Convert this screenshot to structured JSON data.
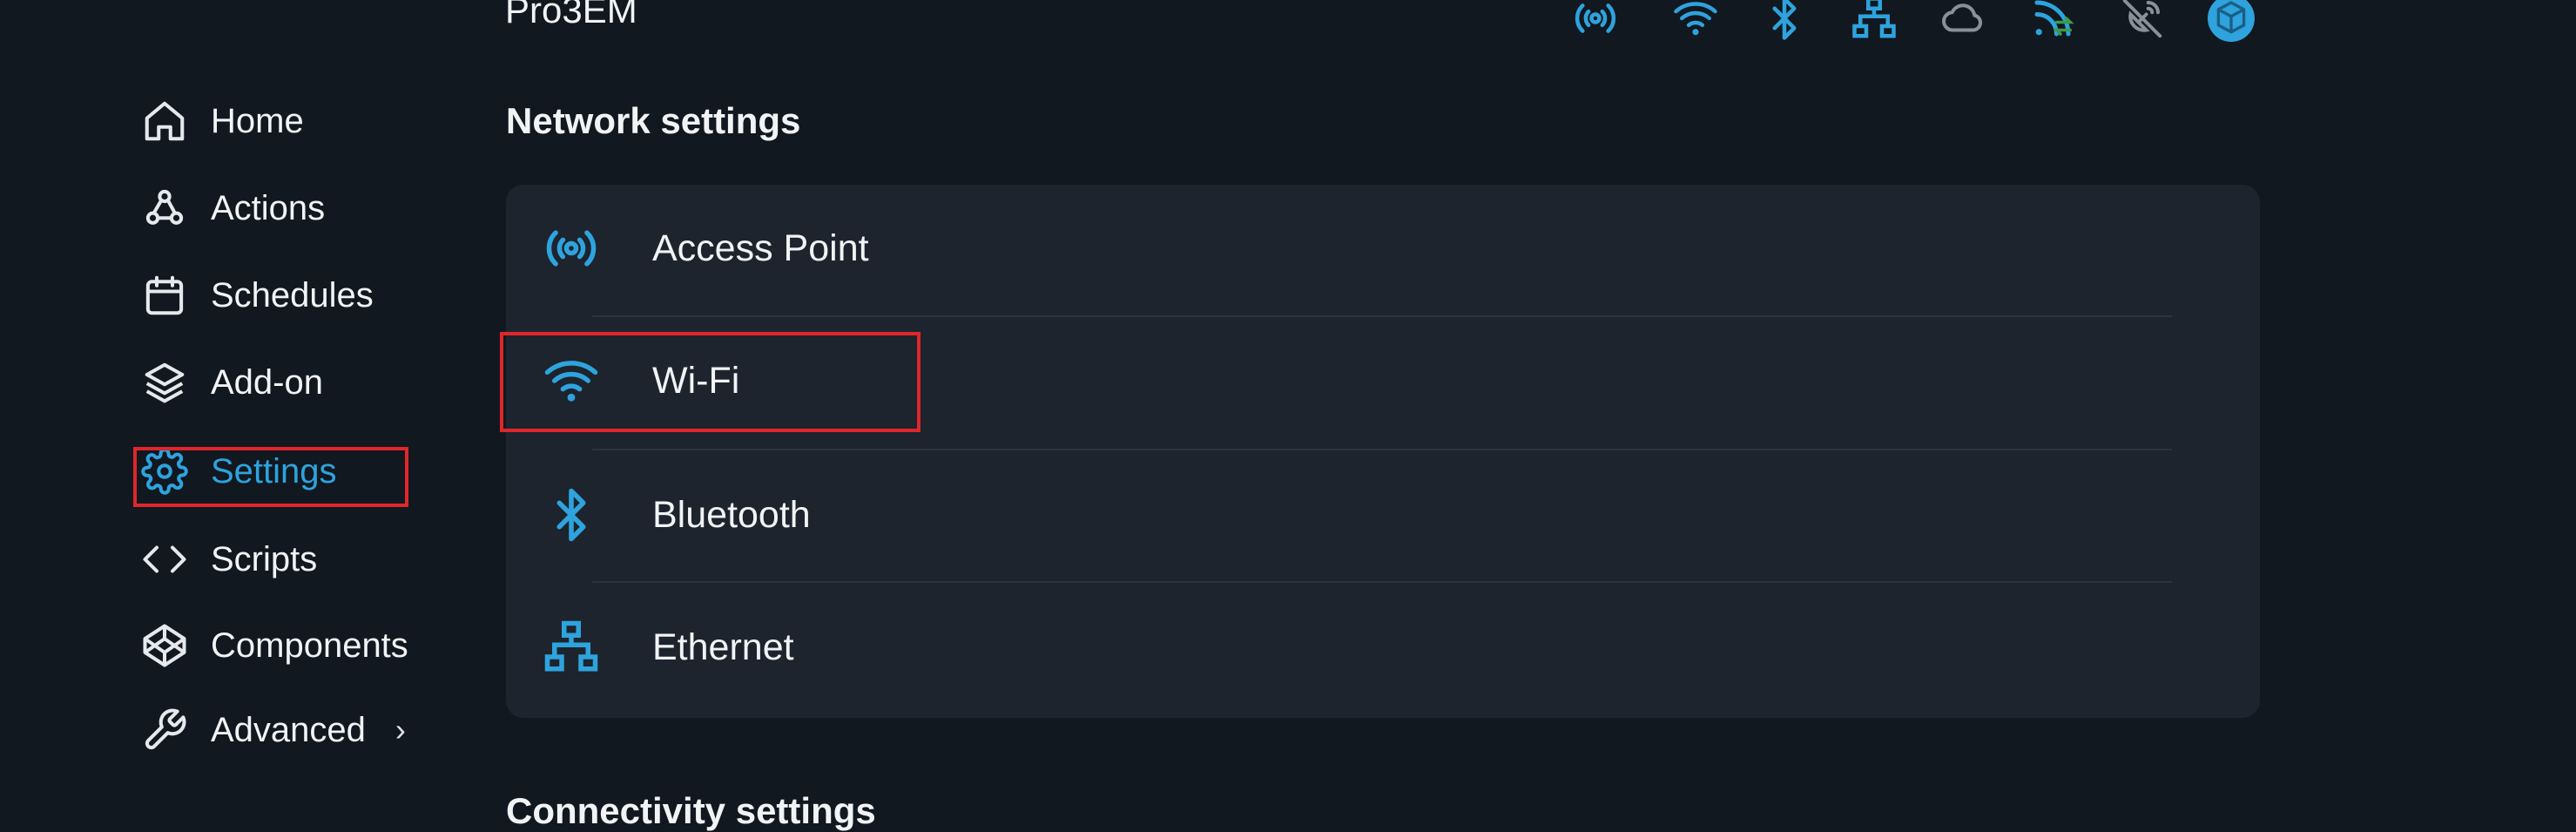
{
  "header": {
    "device_name": "Pro3EM",
    "status_icons": [
      {
        "name": "access-point-icon",
        "color": "#2ea3dd"
      },
      {
        "name": "wifi-icon",
        "color": "#2ea3dd"
      },
      {
        "name": "bluetooth-icon",
        "color": "#2ea3dd"
      },
      {
        "name": "ethernet-icon",
        "color": "#2ea3dd"
      },
      {
        "name": "cloud-icon",
        "color": "#8a9099"
      },
      {
        "name": "rss-sync-icon",
        "color": "#2ea3dd"
      },
      {
        "name": "satellite-dish-off-icon",
        "color": "#8a9099"
      },
      {
        "name": "cube-icon",
        "color": "#2ea3dd"
      }
    ]
  },
  "sidebar": {
    "items": [
      {
        "label": "Home",
        "icon": "home-icon"
      },
      {
        "label": "Actions",
        "icon": "webhook-icon"
      },
      {
        "label": "Schedules",
        "icon": "calendar-icon"
      },
      {
        "label": "Add-on",
        "icon": "layers-icon"
      },
      {
        "label": "Settings",
        "icon": "gear-icon",
        "active": true
      },
      {
        "label": "Scripts",
        "icon": "code-icon"
      },
      {
        "label": "Components",
        "icon": "codepen-icon"
      },
      {
        "label": "Advanced",
        "icon": "wrench-icon",
        "chevron": "›"
      }
    ]
  },
  "main": {
    "network_title": "Network settings",
    "network_items": [
      {
        "label": "Access Point",
        "icon": "access-point-icon"
      },
      {
        "label": "Wi-Fi",
        "icon": "wifi-icon"
      },
      {
        "label": "Bluetooth",
        "icon": "bluetooth-icon"
      },
      {
        "label": "Ethernet",
        "icon": "ethernet-icon"
      }
    ],
    "connectivity_title": "Connectivity settings"
  },
  "colors": {
    "background": "#111820",
    "card": "#1d242d",
    "accent": "#2ea3dd",
    "highlight": "#e0262a",
    "text": "#f1f3f5"
  }
}
